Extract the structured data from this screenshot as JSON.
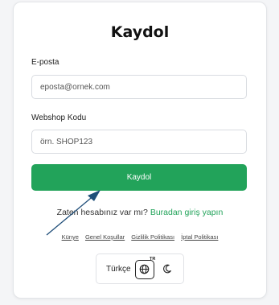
{
  "form": {
    "title": "Kaydol",
    "email_label": "E-posta",
    "email_placeholder": "eposta@ornek.com",
    "shop_label": "Webshop Kodu",
    "shop_placeholder": "örn. SHOP123",
    "submit_label": "Kaydol"
  },
  "login_prompt": {
    "text": "Zaten hesabınız var mı?",
    "link": "Buradan giriş yapın"
  },
  "footer_links": [
    "Künye",
    "Genel Koşullar",
    "Gizlilik Politikası",
    "İptal Politikası"
  ],
  "toolbar": {
    "language_label": "Türkçe",
    "language_code": "TR",
    "globe_icon": "globe-icon",
    "theme_icon": "moon-icon"
  },
  "colors": {
    "accent": "#22a35a",
    "annotation_arrow": "#1f4e79"
  }
}
